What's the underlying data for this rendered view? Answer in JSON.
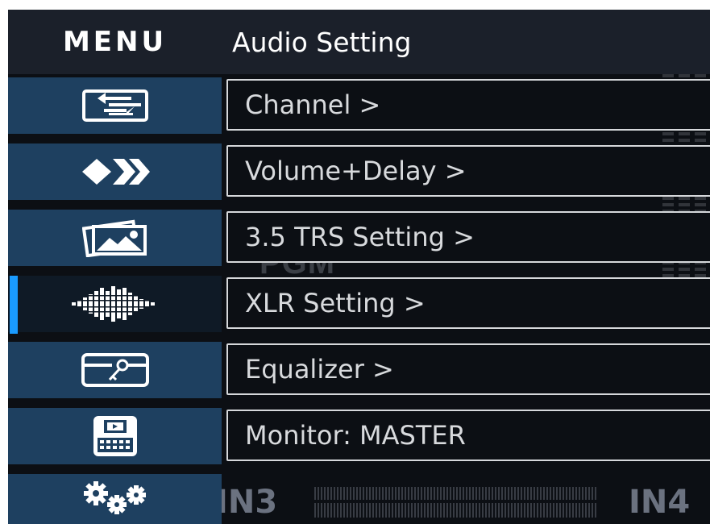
{
  "header": {
    "menu_title": "MENU",
    "page_title": "Audio Setting"
  },
  "background": {
    "overlay_text": "PGM",
    "input_labels": [
      "IN3",
      "IN4"
    ]
  },
  "sidebar": {
    "active_index": 3,
    "items": [
      {
        "icon": "input-switch-icon"
      },
      {
        "icon": "transition-arrows-icon"
      },
      {
        "icon": "picture-icon"
      },
      {
        "icon": "audio-waveform-icon"
      },
      {
        "icon": "key-card-icon"
      },
      {
        "icon": "recorder-device-icon"
      },
      {
        "icon": "gears-icon"
      }
    ]
  },
  "options": [
    {
      "label": "Channel >"
    },
    {
      "label": "Volume+Delay >"
    },
    {
      "label": "3.5 TRS Setting >"
    },
    {
      "label": "XLR Setting >"
    },
    {
      "label": "Equalizer >"
    },
    {
      "label": "Monitor: MASTER"
    }
  ],
  "colors": {
    "accent": "#1a9bff",
    "sidebar_bg": "#1e4060",
    "header_bg": "#1b202a",
    "screen_bg": "#0c0f14"
  }
}
